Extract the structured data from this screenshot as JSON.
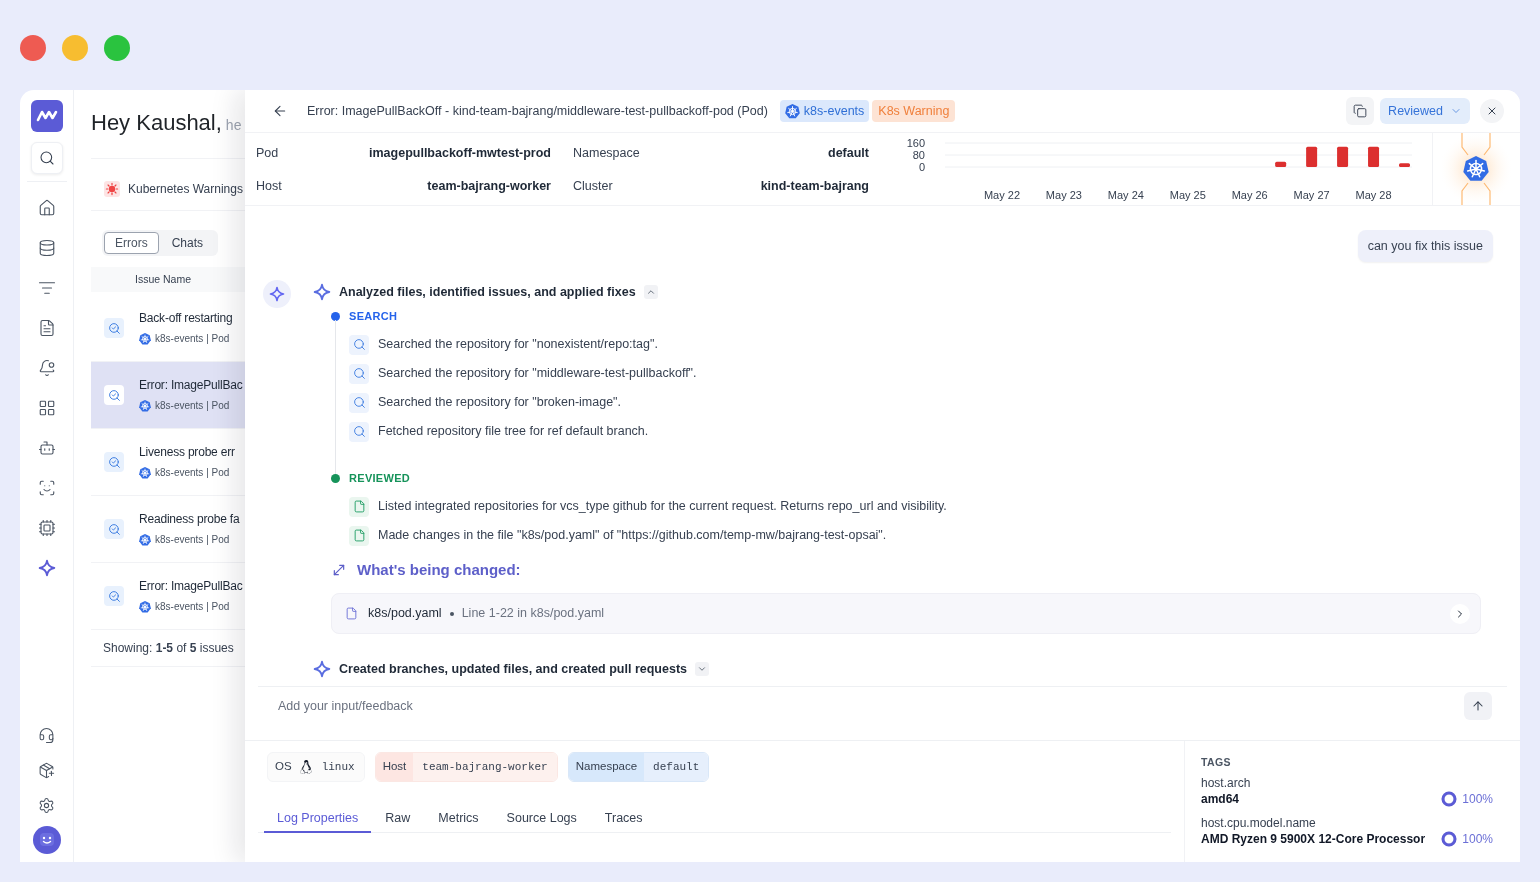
{
  "window_controls": [
    {
      "color": "#ee5b52"
    },
    {
      "color": "#f7bd30"
    },
    {
      "color": "#2ac33f"
    }
  ],
  "sidebar": {
    "nav": [
      {
        "selected": false
      },
      {
        "selected": false
      },
      {
        "selected": false
      },
      {
        "selected": false
      },
      {
        "selected": false
      },
      {
        "selected": false
      },
      {
        "selected": false
      },
      {
        "selected": false
      },
      {
        "selected": false
      },
      {
        "selected": true
      }
    ]
  },
  "greeting": {
    "title": "Hey Kaushal,",
    "subtitle": "he"
  },
  "source": {
    "label": "Kubernetes Warnings"
  },
  "list_tabs": [
    {
      "label": "Errors",
      "selected": true
    },
    {
      "label": "Chats",
      "selected": false
    }
  ],
  "issues": {
    "column": "Issue Name",
    "rows": [
      {
        "title": "Back-off restarting",
        "meta": "k8s-events | Pod",
        "selected": false
      },
      {
        "title": "Error: ImagePullBac",
        "meta": "k8s-events | Pod",
        "selected": true
      },
      {
        "title": "Liveness probe err",
        "meta": "k8s-events | Pod",
        "selected": false
      },
      {
        "title": "Readiness probe fa",
        "meta": "k8s-events | Pod",
        "selected": false
      },
      {
        "title": "Error: ImagePullBac",
        "meta": "k8s-events | Pod",
        "selected": false
      }
    ],
    "footer": "Showing: **1-5** of **5** issues"
  },
  "drawer": {
    "title": "Error: ImagePullBackOff - kind-team-bajrang/middleware-test-pullbackoff-pod (Pod)",
    "badges": [
      {
        "label": "k8s-events",
        "kind": "source"
      },
      {
        "label": "K8s Warning",
        "kind": "warning"
      }
    ],
    "status": "Reviewed"
  },
  "details": [
    {
      "label": "Pod",
      "value": "imagepullbackoff-mwtest-prod"
    },
    {
      "label": "Namespace",
      "value": "default"
    },
    {
      "label": "Host",
      "value": "team-bajrang-worker"
    },
    {
      "label": "Cluster",
      "value": "kind-team-bajrang"
    }
  ],
  "chart_data": {
    "type": "bar",
    "categories": [
      "May 22",
      null,
      "May 23",
      null,
      "May 24",
      null,
      "May 25",
      null,
      "May 26",
      null,
      "May 27",
      null,
      "May 28",
      null
    ],
    "values": [
      null,
      null,
      null,
      null,
      null,
      null,
      null,
      null,
      null,
      35,
      135,
      135,
      135,
      25
    ],
    "ylim": [
      0,
      160
    ],
    "yticks": [
      0,
      80,
      160
    ]
  },
  "chat": {
    "user_message": "can you fix this issue",
    "steps": [
      {
        "title": "Analyzed files, identified issues, and applied fixes",
        "expanded": true,
        "groups": [
          {
            "label": "SEARCH",
            "kind": "search",
            "color": "#2563eb",
            "items": [
              "Searched the repository for \"nonexistent/repo:tag\".",
              "Searched the repository for \"middleware-test-pullbackoff\".",
              "Searched the repository for \"broken-image\".",
              "Fetched repository file tree for ref default branch."
            ]
          },
          {
            "label": "REVIEWED",
            "kind": "file",
            "color": "#16935a",
            "items": [
              "Listed integrated repositories for vcs_type github for the current request. Returns repo_url and visibility.",
              "Made changes in the file \"k8s/pod.yaml\" of \"https://github.com/temp-mw/bajrang-test-opsai\"."
            ]
          }
        ],
        "changes": {
          "heading": "What's being changed:",
          "files": [
            {
              "name": "k8s/pod.yaml",
              "detail": "Line 1-22 in k8s/pod.yaml"
            }
          ]
        }
      },
      {
        "title": "Created branches, updated files, and created pull requests",
        "expanded": false
      }
    ]
  },
  "feedback": {
    "placeholder": "Add your input/feedback"
  },
  "attributes": [
    {
      "key": "OS",
      "value": "linux",
      "kind": "os"
    },
    {
      "key": "Host",
      "value": "team-bajrang-worker",
      "kind": "host"
    },
    {
      "key": "Namespace",
      "value": "default",
      "kind": "namespace"
    }
  ],
  "bottom_tabs": [
    {
      "label": "Log Properties",
      "selected": true
    },
    {
      "label": "Raw",
      "selected": false
    },
    {
      "label": "Metrics",
      "selected": false
    },
    {
      "label": "Source Logs",
      "selected": false
    },
    {
      "label": "Traces",
      "selected": false
    }
  ],
  "tags": {
    "heading": "TAGS",
    "items": [
      {
        "key": "host.arch",
        "value": "amd64",
        "share": "100%",
        "level": 1
      },
      {
        "key": "host.cpu.model.name",
        "value": "AMD Ryzen 9 5900X 12-Core Processor",
        "share": "100%",
        "level": 1
      }
    ]
  }
}
